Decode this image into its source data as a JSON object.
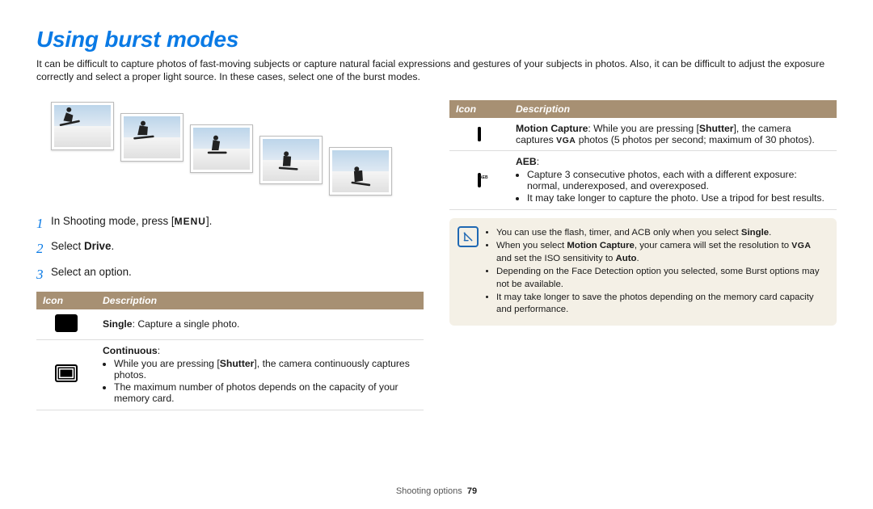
{
  "title": "Using burst modes",
  "intro": "It can be difficult to capture photos of fast-moving subjects or capture natural facial expressions and gestures of your subjects in photos. Also, it can be difficult to adjust the exposure correctly and select a proper light source. In these cases, select one of the burst modes.",
  "steps": [
    {
      "num": "1",
      "pre": "In Shooting mode, press [",
      "word": "MENU",
      "post": "]."
    },
    {
      "num": "2",
      "pre": "Select ",
      "bold": "Drive",
      "post": "."
    },
    {
      "num": "3",
      "pre": "Select an option.",
      "bold": "",
      "post": ""
    }
  ],
  "tableHeaders": {
    "icon": "Icon",
    "desc": "Description"
  },
  "leftRows": {
    "single": {
      "label": "Single",
      "text": ": Capture a single photo."
    },
    "continuous": {
      "label": "Continuous",
      "text": ":",
      "bullets_part_a": "While you are pressing [",
      "bullets_part_bold": "Shutter",
      "bullets_part_b": "], the camera continuously captures photos.",
      "bullet2": "The maximum number of photos depends on the capacity of your memory card."
    }
  },
  "rightRows": {
    "motion": {
      "label": "Motion Capture",
      "pre": ": While you are pressing [",
      "bold": "Shutter",
      "mid": "], the camera captures ",
      "vga": "VGA",
      "post": " photos (5 photos per second; maximum of 30 photos)."
    },
    "aeb": {
      "label": "AEB",
      "text": ":",
      "b1": "Capture 3 consecutive photos, each with a different exposure: normal, underexposed, and overexposed.",
      "b2": "It may take longer to capture the photo. Use a tripod for best results."
    }
  },
  "notes": {
    "n1a": "You can use the flash, timer, and ACB only when you select ",
    "n1bold": "Single",
    "n1b": ".",
    "n2a": "When you select ",
    "n2bold1": "Motion Capture",
    "n2b": ", your camera will set the resolution to ",
    "n2vga": "VGA",
    "n2c": " and set the ISO sensitivity to ",
    "n2bold2": "Auto",
    "n2d": ".",
    "n3": "Depending on the Face Detection option you selected, some Burst options may not be available.",
    "n4": "It may take longer to save the photos depending on the memory card capacity and performance."
  },
  "footer": {
    "section": "Shooting options",
    "page": "79"
  }
}
